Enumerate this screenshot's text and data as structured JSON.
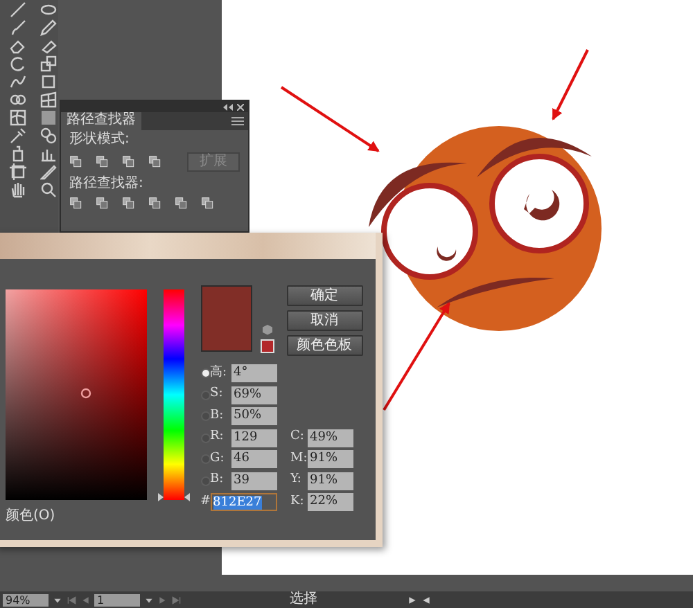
{
  "pathfinder_panel": {
    "tab": "路径查找器",
    "shape_modes_label": "形状模式:",
    "expand_button": {
      "label": "扩展",
      "disabled": true
    },
    "pathfinders_label": "路径查找器:"
  },
  "color_picker": {
    "hue_slider": {
      "level": 0.01
    },
    "buttons": [
      "确定",
      "取消",
      "颜色色板"
    ],
    "hsb_rgb_fields": [
      {
        "label": "高:",
        "value": "4°",
        "selected": true
      },
      {
        "label": "S:",
        "value": "69%",
        "selected": false
      },
      {
        "label": "B:",
        "value": "50%",
        "selected": false
      },
      {
        "label": "R:",
        "value": "129",
        "selected": false
      },
      {
        "label": "G:",
        "value": "46",
        "selected": false
      },
      {
        "label": "B:",
        "value": "39",
        "selected": false
      }
    ],
    "hex_field": {
      "label": "#",
      "value": "812E27"
    },
    "cmyk_fields": [
      {
        "label": "C:",
        "value": "49%"
      },
      {
        "label": "M:",
        "value": "91%"
      },
      {
        "label": "Y:",
        "value": "91%"
      },
      {
        "label": "K:",
        "value": "22%"
      }
    ],
    "web_colors_label": "颜色(O)"
  },
  "status_bar": {
    "zoom": "94%",
    "page": "1",
    "tool": "选择"
  }
}
